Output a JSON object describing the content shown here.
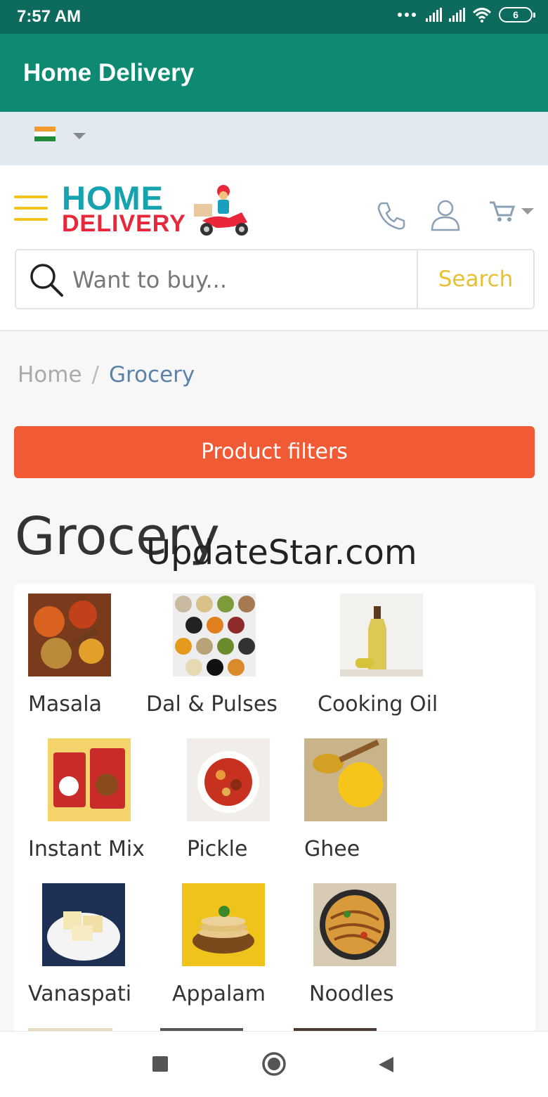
{
  "status_bar": {
    "time": "7:57 AM",
    "battery": "6"
  },
  "app_bar": {
    "title": "Home Delivery"
  },
  "language": {
    "flag": "india-flag-icon"
  },
  "logo": {
    "line1": "HOME",
    "line2": "DELIVERY"
  },
  "search": {
    "placeholder": "Want to buy...",
    "button": "Search"
  },
  "breadcrumb": {
    "home": "Home",
    "separator": "/",
    "current": "Grocery"
  },
  "filters_button": "Product filters",
  "page_heading": "Grocery",
  "watermark": "UpdateStar.com",
  "categories": [
    {
      "label": "Masala"
    },
    {
      "label": "Dal & Pulses"
    },
    {
      "label": "Cooking Oil"
    },
    {
      "label": "Instant Mix"
    },
    {
      "label": "Pickle"
    },
    {
      "label": "Ghee"
    },
    {
      "label": "Vanaspati"
    },
    {
      "label": "Appalam"
    },
    {
      "label": "Noodles"
    }
  ],
  "colors": {
    "appbar": "#0f8a72",
    "statusbar": "#0c6b5c",
    "accent_orange": "#f05a35",
    "accent_yellow": "#f0c419",
    "link_blue": "#5b82a8"
  }
}
